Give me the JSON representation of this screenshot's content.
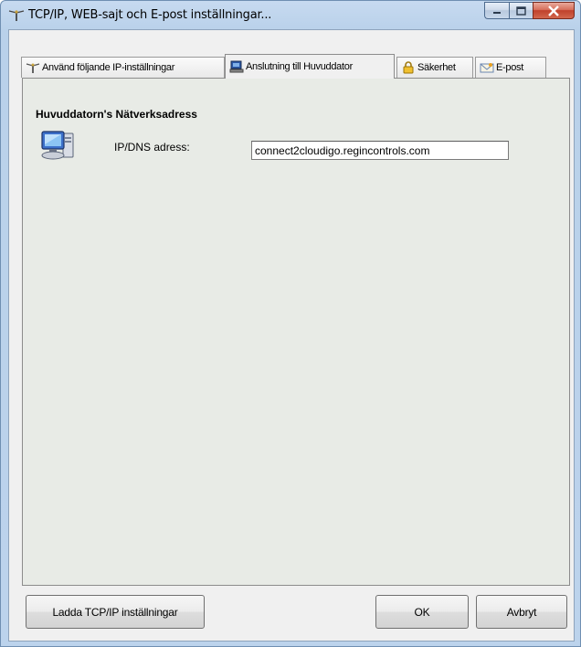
{
  "window": {
    "title": "TCP/IP, WEB-sajt och E-post inställningar..."
  },
  "tabs": [
    {
      "label": "Använd följande IP-inställningar",
      "icon": "network-antenna-icon",
      "active": false
    },
    {
      "label": "Anslutning till Huvuddator",
      "icon": "computer-icon",
      "active": true
    },
    {
      "label": "Säkerhet",
      "icon": "padlock-icon",
      "active": false
    },
    {
      "label": "E-post",
      "icon": "envelope-icon",
      "active": false
    }
  ],
  "panel": {
    "section_title": "Huvuddatorn's Nätverksadress",
    "ip_label": "IP/DNS adress:",
    "ip_value": "connect2cloudigo.regincontrols.com"
  },
  "buttons": {
    "load": "Ladda TCP/IP inställningar",
    "ok": "OK",
    "cancel": "Avbryt"
  }
}
